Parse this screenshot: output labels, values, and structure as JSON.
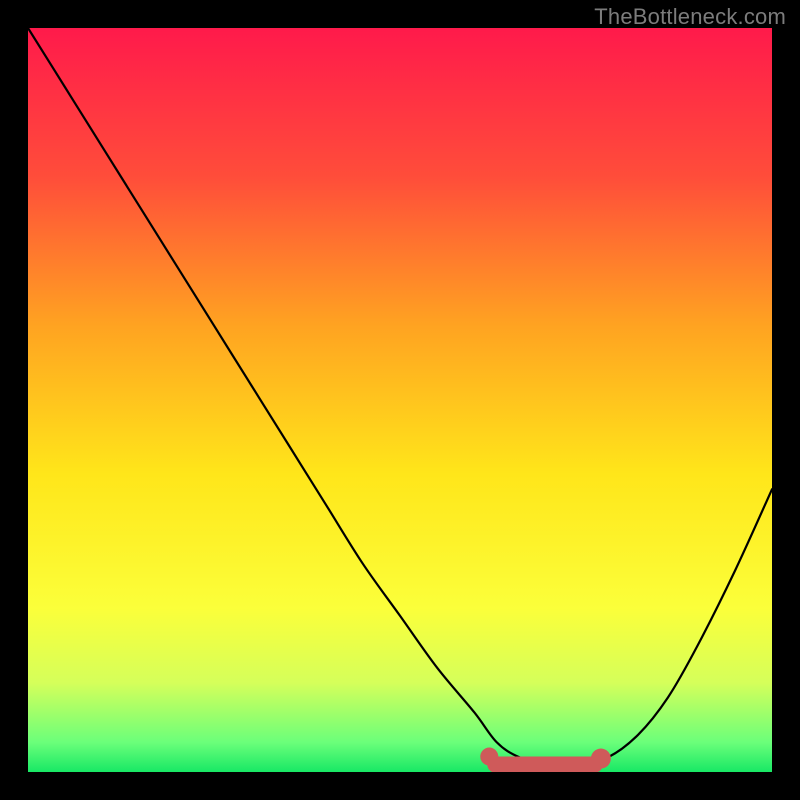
{
  "watermark": "TheBottleneck.com",
  "colors": {
    "background": "#000000",
    "gradient_stops": [
      {
        "offset": 0.0,
        "color": "#ff1a4b"
      },
      {
        "offset": 0.2,
        "color": "#ff4d3a"
      },
      {
        "offset": 0.4,
        "color": "#ffa321"
      },
      {
        "offset": 0.6,
        "color": "#ffe61a"
      },
      {
        "offset": 0.78,
        "color": "#fbff3a"
      },
      {
        "offset": 0.88,
        "color": "#d5ff5a"
      },
      {
        "offset": 0.96,
        "color": "#6bff7a"
      },
      {
        "offset": 1.0,
        "color": "#18e865"
      }
    ],
    "curve": "#000000",
    "valley_marker": "#cf5a5a"
  },
  "chart_data": {
    "type": "line",
    "title": "",
    "xlabel": "",
    "ylabel": "",
    "xlim": [
      0,
      100
    ],
    "ylim": [
      0,
      100
    ],
    "grid": false,
    "series": [
      {
        "name": "bottleneck-curve",
        "x": [
          0,
          5,
          10,
          15,
          20,
          25,
          30,
          35,
          40,
          45,
          50,
          55,
          60,
          63,
          66,
          70,
          74,
          78,
          82,
          86,
          90,
          95,
          100
        ],
        "y": [
          100,
          92,
          84,
          76,
          68,
          60,
          52,
          44,
          36,
          28,
          21,
          14,
          8,
          4,
          2,
          1,
          1,
          2,
          5,
          10,
          17,
          27,
          38
        ]
      }
    ],
    "annotations": [
      {
        "name": "valley-marker",
        "shape": "rounded-segment",
        "x_range": [
          62,
          77
        ],
        "y": 1
      }
    ],
    "background_gradient": {
      "direction": "top-to-bottom",
      "meaning": "red=high bottleneck, green=low bottleneck"
    }
  }
}
